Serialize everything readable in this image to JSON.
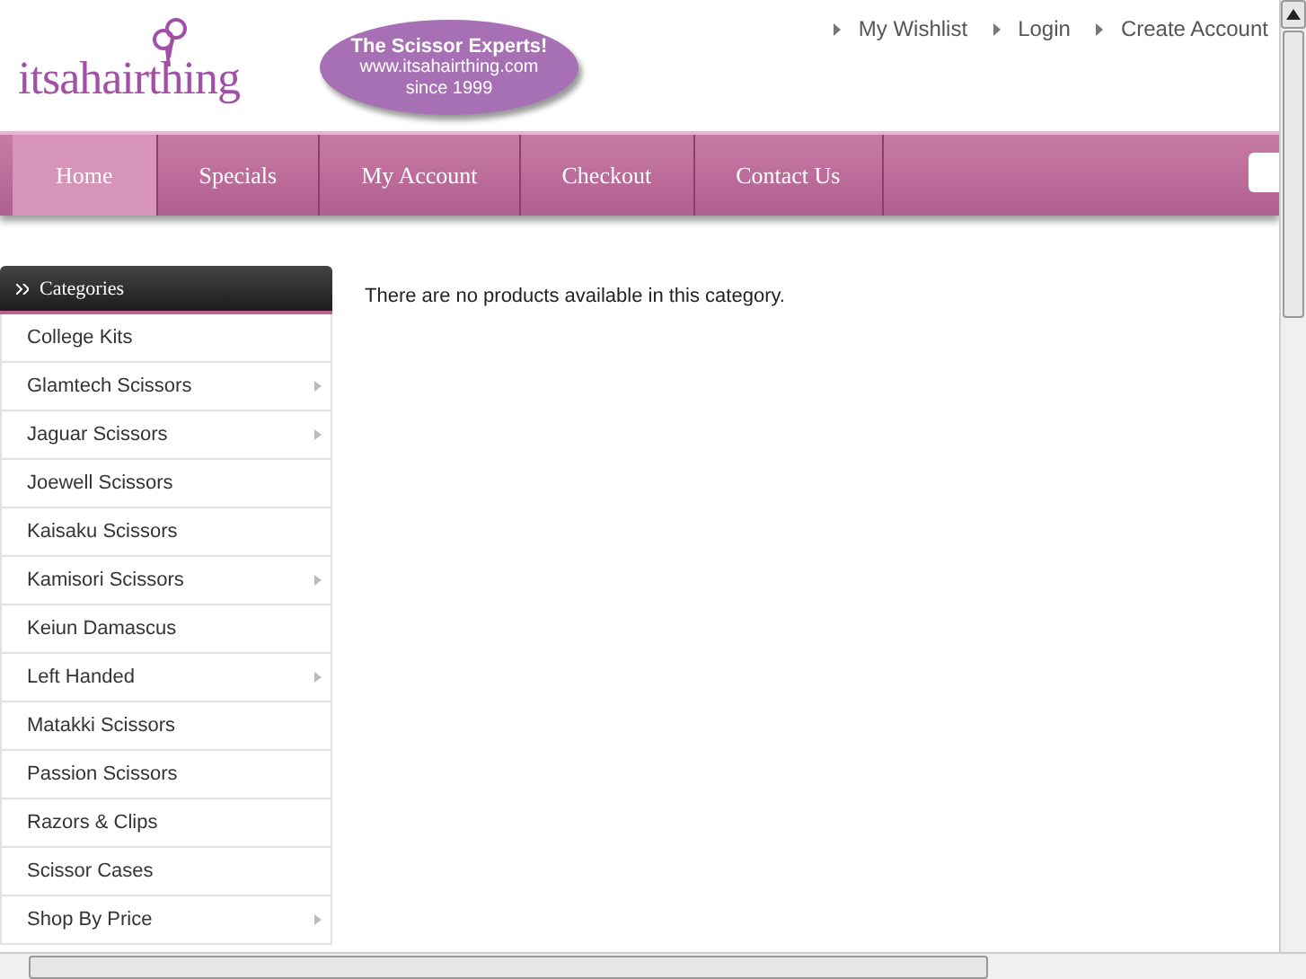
{
  "logo": {
    "text": "itsahairthing"
  },
  "badge": {
    "lines": [
      "The Scissor Experts!",
      "www.itsahairthing.com",
      "since 1999"
    ]
  },
  "top_links": [
    "My Wishlist",
    "Login",
    "Create Account"
  ],
  "nav": [
    {
      "label": "Home",
      "selected": true
    },
    {
      "label": "Specials",
      "selected": false
    },
    {
      "label": "My Account",
      "selected": false
    },
    {
      "label": "Checkout",
      "selected": false
    },
    {
      "label": "Contact Us",
      "selected": false
    }
  ],
  "sidebar": {
    "title": "Categories",
    "items": [
      {
        "label": "College Kits",
        "has_children": false
      },
      {
        "label": "Glamtech Scissors",
        "has_children": true
      },
      {
        "label": "Jaguar Scissors",
        "has_children": true
      },
      {
        "label": "Joewell Scissors",
        "has_children": false
      },
      {
        "label": "Kaisaku Scissors",
        "has_children": false
      },
      {
        "label": "Kamisori Scissors",
        "has_children": true
      },
      {
        "label": "Keiun Damascus",
        "has_children": false
      },
      {
        "label": "Left Handed",
        "has_children": true
      },
      {
        "label": "Matakki Scissors",
        "has_children": false
      },
      {
        "label": "Passion Scissors",
        "has_children": false
      },
      {
        "label": "Razors & Clips",
        "has_children": false
      },
      {
        "label": "Scissor Cases",
        "has_children": false
      },
      {
        "label": "Shop By Price",
        "has_children": true
      }
    ]
  },
  "message": "There are no products available in this category."
}
